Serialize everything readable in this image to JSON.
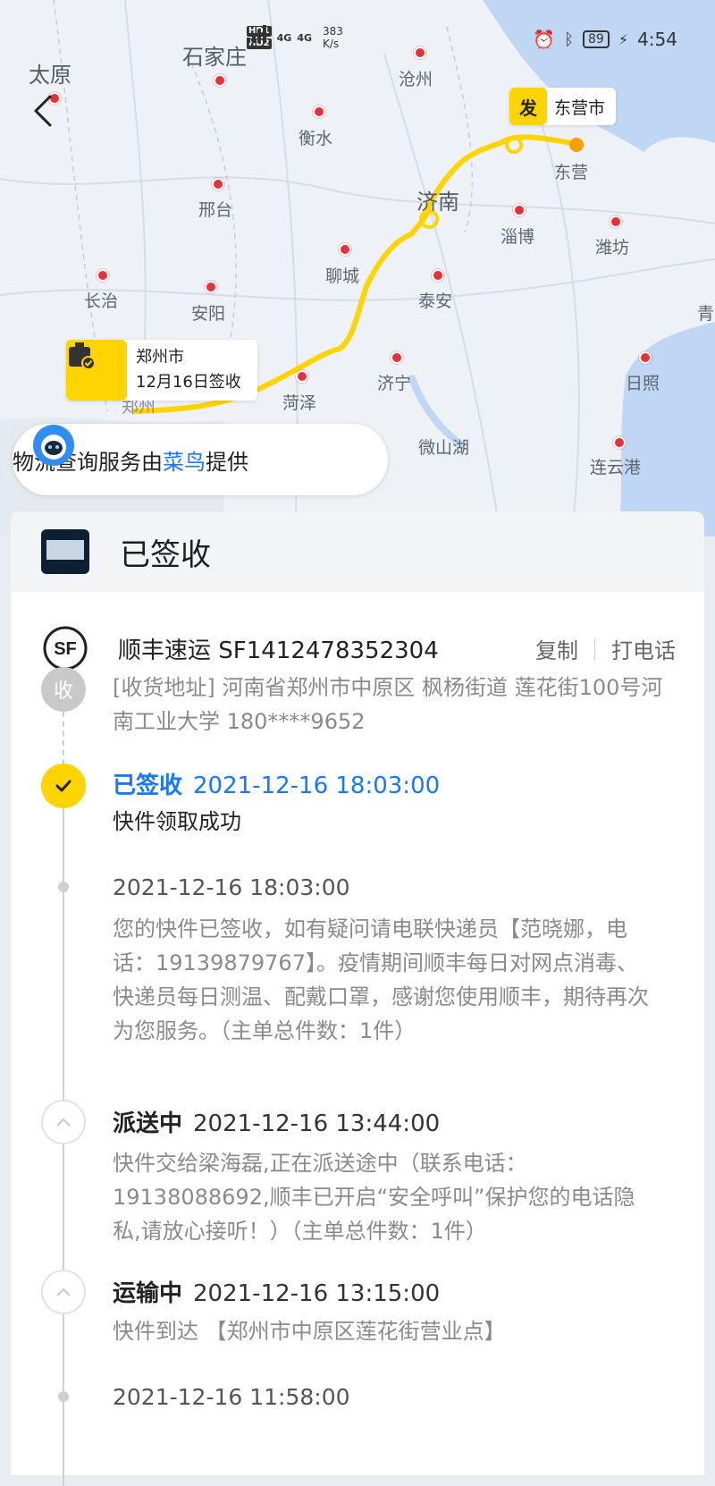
{
  "status_bar": {
    "hd1": "HD1",
    "hd2": "HD2",
    "net1": "4G",
    "net2": "4G",
    "speed": "383",
    "speed_unit": "K/s",
    "battery": "89",
    "time": "4:54"
  },
  "map": {
    "cities": [
      {
        "name": "太原"
      },
      {
        "name": "石家庄"
      },
      {
        "name": "沧州"
      },
      {
        "name": "衡水"
      },
      {
        "name": "邢台"
      },
      {
        "name": "济南"
      },
      {
        "name": "东营"
      },
      {
        "name": "淄博"
      },
      {
        "name": "潍坊"
      },
      {
        "name": "长治"
      },
      {
        "name": "安阳"
      },
      {
        "name": "聊城"
      },
      {
        "name": "泰安"
      },
      {
        "name": "菏泽"
      },
      {
        "name": "济宁"
      },
      {
        "name": "日照"
      },
      {
        "name": "微山湖"
      },
      {
        "name": "连云港"
      },
      {
        "name": "郑州"
      },
      {
        "name": "青"
      }
    ],
    "start_marker": {
      "badge": "发",
      "city": "东营市"
    },
    "end_marker": {
      "city": "郑州市",
      "note": "12月16日签收"
    },
    "route_color": "#ffd400",
    "dot_color": "#e6313a"
  },
  "provider": {
    "prefix": "物流查询服务由",
    "brand": "菜鸟",
    "suffix": "提供",
    "brand_color": "#1677ff"
  },
  "package": {
    "status": "已签收"
  },
  "courier": {
    "label": "顺丰速运 SF1412478352304",
    "copy": "复制",
    "call": "打电话"
  },
  "timeline": {
    "recv_badge": "收",
    "address": "[收货地址] 河南省郑州市中原区 枫杨街道 莲花街100号河南工业大学 180****9652",
    "events": [
      {
        "status": "已签收",
        "time": "2021-12-16 18:03:00",
        "desc": "快件领取成功"
      },
      {
        "status": "",
        "time": "2021-12-16 18:03:00",
        "desc": "您的快件已签收，如有疑问请电联快递员【范晓娜，电话：19139879767】。疫情期间顺丰每日对网点消毒、快递员每日测温、配戴口罩，感谢您使用顺丰，期待再次为您服务。（主单总件数：1件）"
      },
      {
        "status": "派送中",
        "time": "2021-12-16 13:44:00",
        "desc": "快件交给梁海磊,正在派送途中（联系电话：19138088692,顺丰已开启“安全呼叫”保护您的电话隐私,请放心接听！）（主单总件数：1件）"
      },
      {
        "status": "运输中",
        "time": "2021-12-16 13:15:00",
        "desc": "快件到达 【郑州市中原区莲花街营业点】"
      },
      {
        "status": "",
        "time": "2021-12-16 11:58:00",
        "desc": ""
      }
    ]
  }
}
